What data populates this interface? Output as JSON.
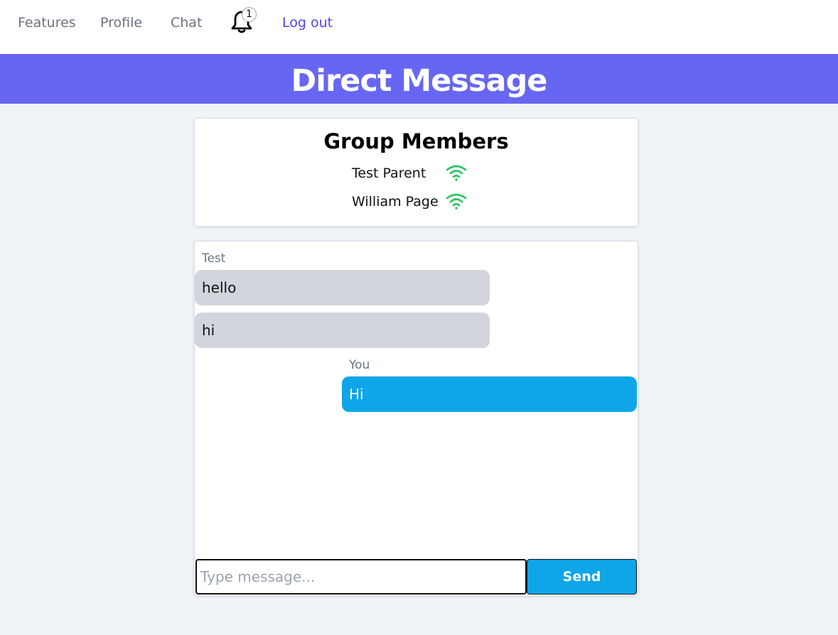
{
  "nav": {
    "features_label": "Features",
    "profile_label": "Profile",
    "chat_label": "Chat",
    "notification_count": "1",
    "logout_label": "Log out",
    "link_color": "#6b7280",
    "logout_color": "#4f46e5",
    "bell_icon": "bell-icon"
  },
  "banner": {
    "title": "Direct Message",
    "background": "#6666f2"
  },
  "members": {
    "title": "Group Members",
    "status_icon": "wifi-icon",
    "status_color": "#22c55e",
    "list": [
      {
        "name": "Test Parent"
      },
      {
        "name": "William Page"
      }
    ]
  },
  "chat": {
    "incoming": {
      "sender": "Test",
      "messages": [
        "hello",
        "hi"
      ],
      "bubble_color": "#d3d5dc"
    },
    "outgoing": {
      "sender": "You",
      "messages": [
        "Hi"
      ],
      "bubble_color": "#0ea5e9"
    },
    "input": {
      "placeholder": "Type message...",
      "value": ""
    },
    "send_label": "Send"
  }
}
